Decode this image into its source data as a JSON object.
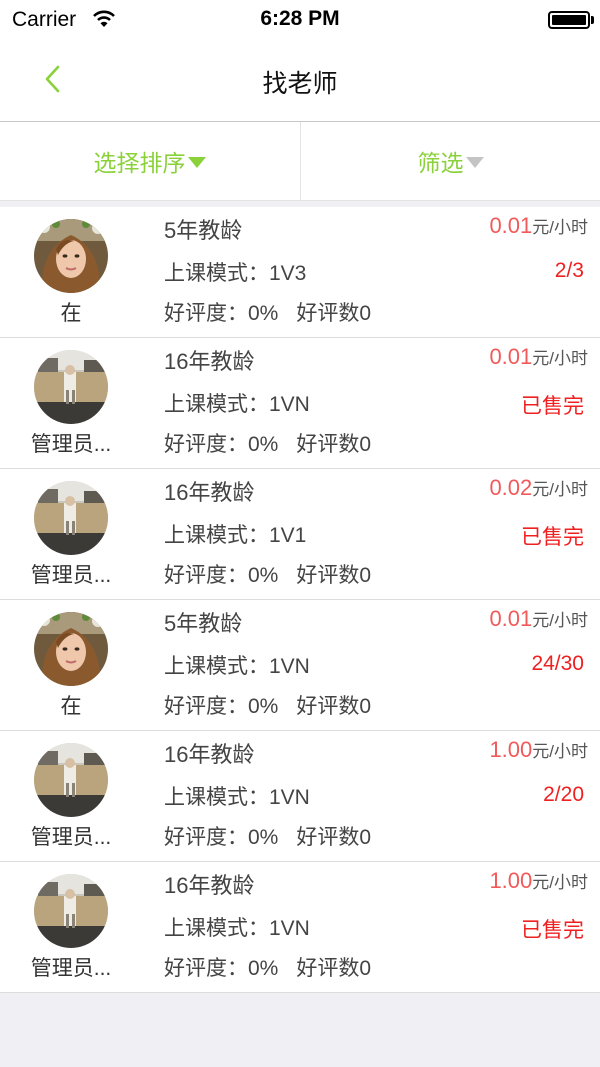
{
  "status_bar": {
    "carrier": "Carrier",
    "time": "6:28 PM"
  },
  "nav": {
    "title": "找老师"
  },
  "filters": {
    "sort_label": "选择排序",
    "filter_label": "筛选"
  },
  "teachers": [
    {
      "name": "在",
      "years": "5年教龄",
      "mode": "上课模式：1V3",
      "rating": "好评度：0%",
      "review_count": "好评数0",
      "price": "0.01",
      "unit": "元/小时",
      "status": "2/3",
      "avatar": "girl-portrait"
    },
    {
      "name": "管理员...",
      "years": "16年教龄",
      "mode": "上课模式：1VN",
      "rating": "好评度：0%",
      "review_count": "好评数0",
      "price": "0.01",
      "unit": "元/小时",
      "status": "已售完",
      "avatar": "street-photo"
    },
    {
      "name": "管理员...",
      "years": "16年教龄",
      "mode": "上课模式：1V1",
      "rating": "好评度：0%",
      "review_count": "好评数0",
      "price": "0.02",
      "unit": "元/小时",
      "status": "已售完",
      "avatar": "street-photo"
    },
    {
      "name": "在",
      "years": "5年教龄",
      "mode": "上课模式：1VN",
      "rating": "好评度：0%",
      "review_count": "好评数0",
      "price": "0.01",
      "unit": "元/小时",
      "status": "24/30",
      "avatar": "girl-portrait"
    },
    {
      "name": "管理员...",
      "years": "16年教龄",
      "mode": "上课模式：1VN",
      "rating": "好评度：0%",
      "review_count": "好评数0",
      "price": "1.00",
      "unit": "元/小时",
      "status": "2/20",
      "avatar": "street-photo"
    },
    {
      "name": "管理员...",
      "years": "16年教龄",
      "mode": "上课模式：1VN",
      "rating": "好评度：0%",
      "review_count": "好评数0",
      "price": "1.00",
      "unit": "元/小时",
      "status": "已售完",
      "avatar": "street-photo"
    }
  ],
  "colors": {
    "accent": "#8ad13a",
    "price": "#f05a5a",
    "status": "#ef2020"
  }
}
